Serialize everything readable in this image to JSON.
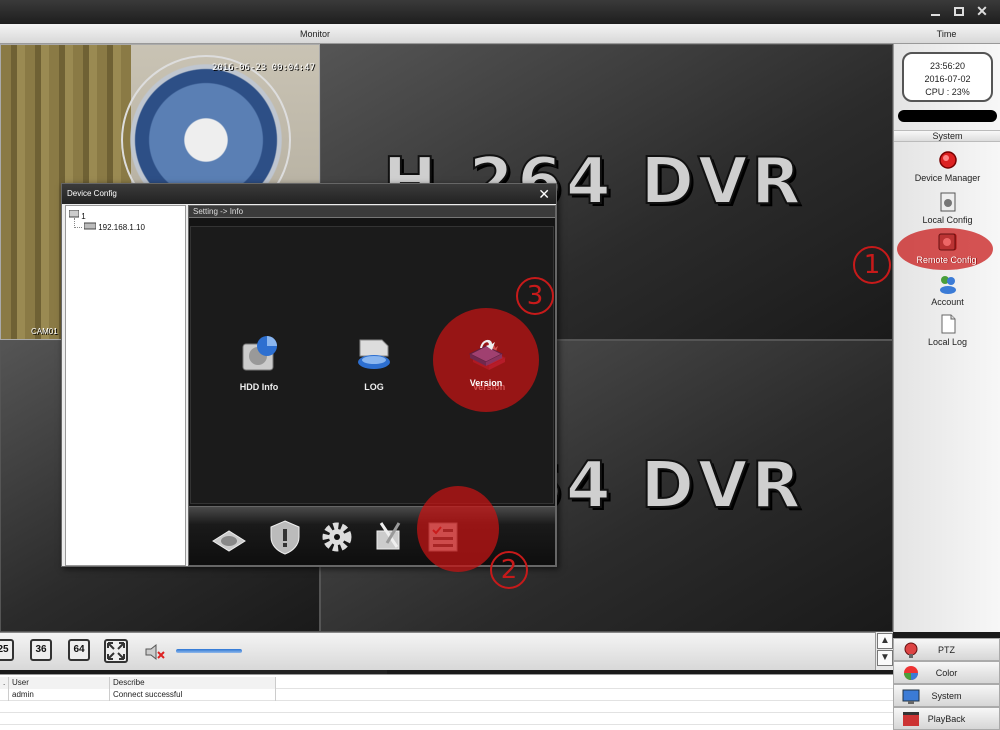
{
  "header": {
    "monitor_label": "Monitor",
    "time_label": "Time"
  },
  "clock": {
    "time": "23:56:20",
    "date": "2016-07-02",
    "cpu": "CPU : 23%"
  },
  "camera": {
    "timestamp": "2016-06-23 00:04:47",
    "label": "CAM01"
  },
  "watermark": {
    "text_top": "H.264 DVR",
    "text_bottom": "H.264 DVR"
  },
  "system_panel": {
    "header": "System",
    "items": [
      {
        "label": "Device Manager",
        "icon": "device-manager-icon"
      },
      {
        "label": "Local Config",
        "icon": "local-config-icon"
      },
      {
        "label": "Remote Config",
        "icon": "remote-config-icon"
      },
      {
        "label": "Account",
        "icon": "account-icon"
      },
      {
        "label": "Local Log",
        "icon": "local-log-icon"
      }
    ]
  },
  "bottom_toolbar": {
    "grid_buttons": [
      "25",
      "36",
      "64"
    ]
  },
  "control_panel": {
    "items": [
      {
        "label": "PTZ",
        "icon": "ptz-icon"
      },
      {
        "label": "Color",
        "icon": "color-icon"
      },
      {
        "label": "System",
        "icon": "system-icon"
      },
      {
        "label": "PlayBack",
        "icon": "playback-icon"
      }
    ]
  },
  "log": {
    "columns": [
      ".",
      "User",
      "Describe"
    ],
    "rows": [
      {
        "index": "",
        "user": "admin",
        "describe": "Connect successful"
      }
    ]
  },
  "dialog": {
    "title": "Device Config",
    "tree": {
      "root": "1",
      "child": "192.168.1.10"
    },
    "breadcrumb": "Setting -> Info",
    "info_items": [
      {
        "label": "HDD Info",
        "icon": "hdd-info-icon"
      },
      {
        "label": "LOG",
        "icon": "log-icon"
      },
      {
        "label": "Version",
        "icon": "version-icon"
      }
    ],
    "toolbar_icons": [
      "hdd-icon",
      "shield-icon",
      "gear-icon",
      "tools-icon",
      "info-list-icon"
    ]
  },
  "annotations": [
    "1",
    "2",
    "3"
  ],
  "colors": {
    "highlight": "#c71a1a",
    "panel_bg": "#141414"
  }
}
